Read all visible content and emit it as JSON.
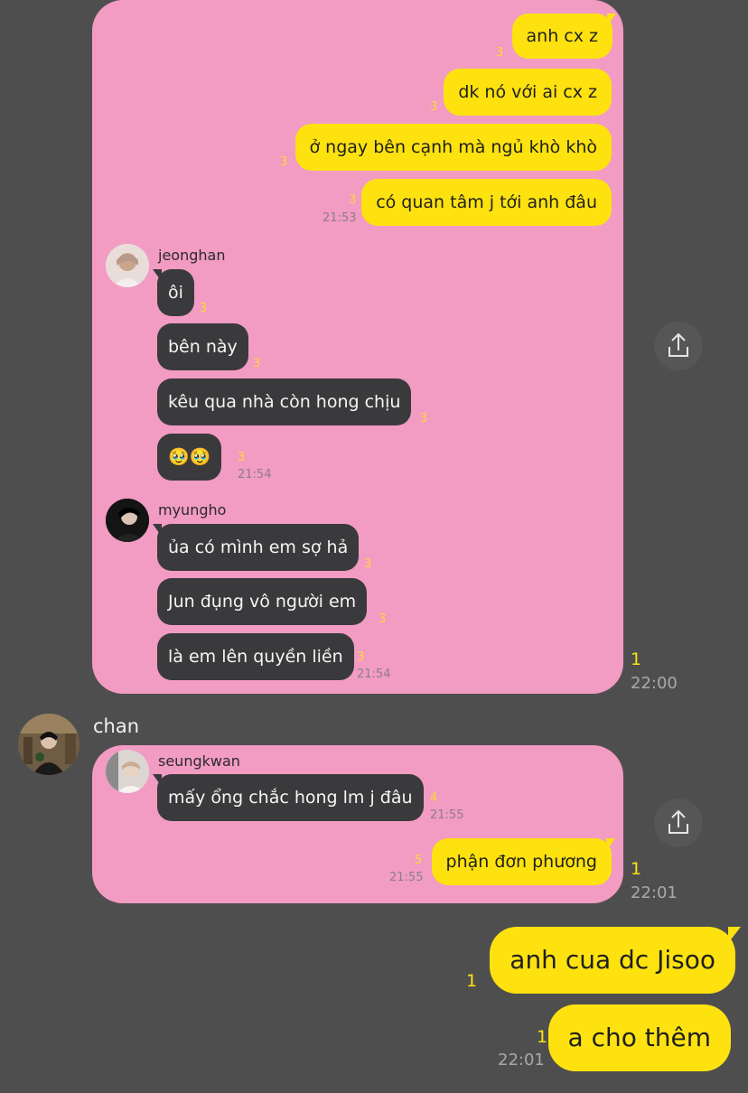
{
  "card1": {
    "sent": [
      {
        "text": "anh cx z",
        "count": "3"
      },
      {
        "text": "dk nó với ai cx z",
        "count": "3"
      },
      {
        "text": "ở ngay bên cạnh mà ngủ khò khò",
        "count": "3"
      },
      {
        "text": "có quan tâm j tới anh đâu",
        "count": "3",
        "time": "21:53"
      }
    ],
    "jeonghan": {
      "name": "jeonghan",
      "msgs": [
        {
          "text": "ôi",
          "count": "3"
        },
        {
          "text": "bên này",
          "count": "3"
        },
        {
          "text": "kêu qua nhà còn hong chịu",
          "count": "3"
        },
        {
          "text": "🥹🥹",
          "count": "3",
          "time": "21:54"
        }
      ]
    },
    "myungho": {
      "name": "myungho",
      "msgs": [
        {
          "text": "ủa có mình em sợ hả",
          "count": "3"
        },
        {
          "text": "Jun đụng vô người em",
          "count": "3"
        },
        {
          "text": "là em lên quyền liền",
          "count": "3",
          "time": "21:54"
        }
      ]
    },
    "outer_count": "1",
    "outer_time": "22:00"
  },
  "chan": {
    "name": "chan"
  },
  "card2": {
    "seungkwan": {
      "name": "seungkwan",
      "text": "mấy ổng chắc hong lm j đâu",
      "count": "4",
      "time": "21:55"
    },
    "sent": {
      "text": "phận đơn phương",
      "count": "5",
      "time": "21:55"
    },
    "outer_count": "1",
    "outer_time": "22:01"
  },
  "outgoing": [
    {
      "text": "anh cua dc Jisoo",
      "count": "1"
    },
    {
      "text": "a cho thêm",
      "count": "1",
      "time": "22:01"
    }
  ],
  "icons": {
    "share": "share-icon"
  },
  "colors": {
    "background": "#4f4e4f",
    "card": "#f29bc3",
    "yellow": "#fde20f",
    "dark_bubble": "#3a3a3c"
  }
}
